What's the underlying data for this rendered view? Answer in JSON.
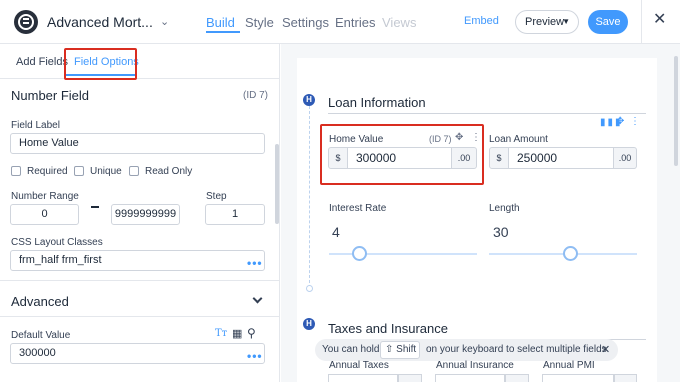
{
  "header": {
    "form_title": "Advanced Mort...",
    "nav": [
      "Build",
      "Style",
      "Settings",
      "Entries",
      "Views"
    ],
    "embed_label": "Embed",
    "preview_label": "Preview",
    "save_label": "Save",
    "accent_color": "#4199fd"
  },
  "sidebar": {
    "tabs": [
      "Add Fields",
      "Field Options"
    ],
    "active_tab": "Field Options",
    "field_type": "Number Field",
    "field_id": "(ID 7)",
    "field_label_label": "Field Label",
    "field_label_value": "Home Value",
    "checkboxes": [
      {
        "label": "Required",
        "checked": false
      },
      {
        "label": "Unique",
        "checked": false
      },
      {
        "label": "Read Only",
        "checked": false
      }
    ],
    "number_range_label": "Number Range",
    "range_min": "0",
    "range_max": "9999999999",
    "step_label": "Step",
    "step_value": "1",
    "css_label": "CSS Layout Classes",
    "css_value": "frm_half frm_first",
    "advanced_label": "Advanced",
    "default_value_label": "Default Value",
    "default_value": "300000",
    "more_icon": "•••"
  },
  "canvas": {
    "section1_title": "Loan Information",
    "section2_title": "Taxes and Insurance",
    "heading_badge": "H",
    "home_value": {
      "label": "Home Value",
      "id": "(ID 7)",
      "prefix": "$",
      "value": "300000",
      "suffix": ".00"
    },
    "loan_amount": {
      "label": "Loan Amount",
      "prefix": "$",
      "value": "250000",
      "suffix": ".00"
    },
    "interest_rate": {
      "label": "Interest Rate",
      "value": "4",
      "fill_fraction": 0.2
    },
    "length": {
      "label": "Length",
      "value": "30",
      "fill_fraction": 0.55
    },
    "hint": {
      "before": "You can hold",
      "key": "Shift",
      "after": "on your keyboard to select multiple fields"
    },
    "taxes_fields": [
      "Annual Taxes",
      "Annual Insurance",
      "Annual PMI"
    ]
  },
  "icons": [
    "logo-icon",
    "chevron-down-icon",
    "close-icon",
    "text-format-icon",
    "calculator-icon",
    "search-icon",
    "columns-icon",
    "move-icon",
    "more-vertical-icon",
    "shift-key-icon"
  ],
  "annotation_color": "#d92d20"
}
